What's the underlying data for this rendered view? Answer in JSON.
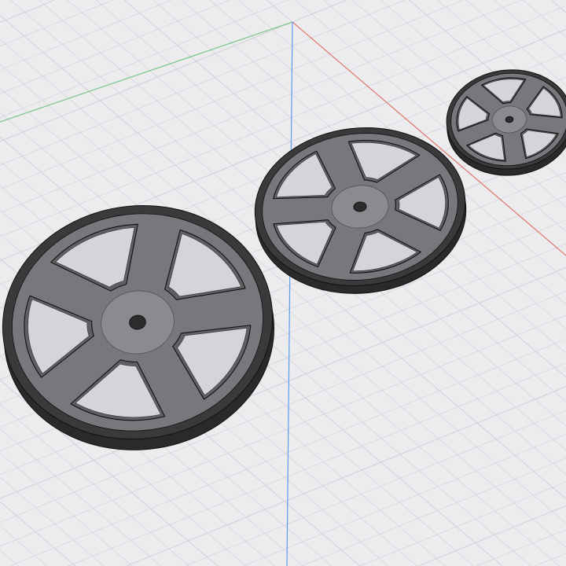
{
  "viewport": {
    "background": "#ececef",
    "grid_color": "#d2d3da",
    "axis_x_color": "#e07a70",
    "axis_y_color": "#7cc58a",
    "axis_z_color": "#5a9cf0"
  },
  "models": [
    {
      "name": "wheel-large",
      "spokes": 5
    },
    {
      "name": "wheel-medium",
      "spokes": 5
    },
    {
      "name": "wheel-small",
      "spokes": 5
    }
  ],
  "colors": {
    "face": "#77787b",
    "face_light": "#8a8b8e",
    "tire": "#2a2a2c",
    "edge": "#111"
  }
}
